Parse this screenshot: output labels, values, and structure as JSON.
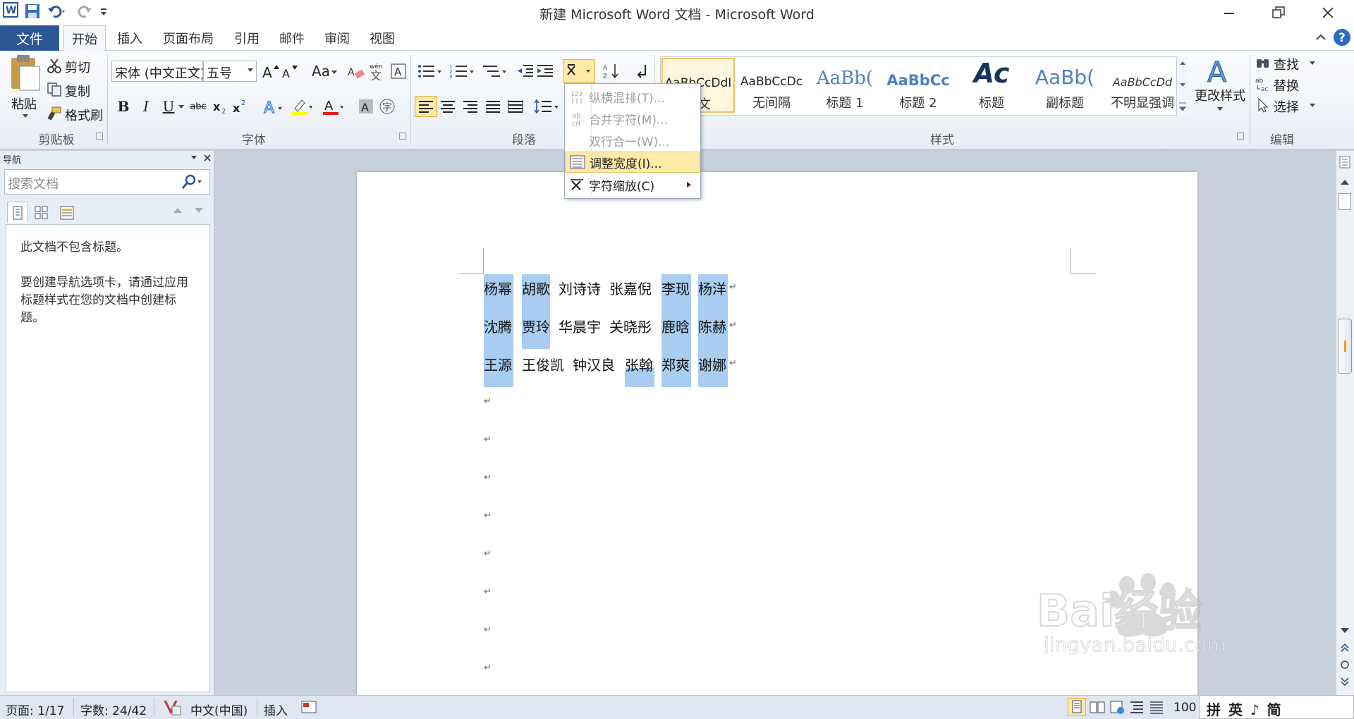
{
  "window": {
    "title": "新建 Microsoft Word 文档 - Microsoft Word"
  },
  "tabs": [
    "文件",
    "开始",
    "插入",
    "页面布局",
    "引用",
    "邮件",
    "审阅",
    "视图"
  ],
  "clipboard": {
    "paste": "粘贴",
    "cut": "剪切",
    "copy": "复制",
    "format_painter": "格式刷",
    "group": "剪贴板"
  },
  "font": {
    "name": "宋体 (中文正文)",
    "size": "五号",
    "group": "字体",
    "case_btn": "Aa"
  },
  "paragraph": {
    "group": "段落"
  },
  "styles": {
    "group": "样式",
    "items": [
      {
        "preview": "AaBbCcDdI",
        "name": "正文"
      },
      {
        "preview": "AaBbCcDc",
        "name": "无间隔"
      },
      {
        "preview": "AaBb(",
        "name": "标题 1"
      },
      {
        "preview": "AaBbCc",
        "name": "标题 2"
      },
      {
        "preview": "Ac",
        "name": "标题"
      },
      {
        "preview": "AaBb(",
        "name": "副标题"
      },
      {
        "preview": "AaBbCcDd",
        "name": "不明显强调"
      }
    ],
    "change_styles": "更改样式"
  },
  "editing": {
    "find": "查找",
    "replace": "替换",
    "select": "选择",
    "group": "编辑"
  },
  "menu": {
    "items": [
      {
        "label": "纵横混排(T)...",
        "enabled": false
      },
      {
        "label": "合并字符(M)...",
        "enabled": false
      },
      {
        "label": "双行合一(W)...",
        "enabled": false
      },
      {
        "label": "调整宽度(I)...",
        "enabled": true,
        "highlighted": true
      },
      {
        "label": "字符缩放(C)",
        "enabled": true,
        "submenu": true
      }
    ]
  },
  "nav": {
    "title": "导航",
    "search_placeholder": "搜索文档",
    "msg1": "此文档不包含标题。",
    "msg2": "要创建导航选项卡，请通过应用标题样式在您的文档中创建标题。"
  },
  "document": {
    "rows": [
      [
        "杨幂",
        "胡歌",
        "刘诗诗",
        "张嘉倪",
        "李现",
        "杨洋"
      ],
      [
        "沈腾",
        "贾玲",
        "华晨宇",
        "关晓彤",
        "鹿晗",
        "陈赫"
      ],
      [
        "王源",
        "王俊凯",
        "钟汉良",
        "张翰",
        "郑爽",
        "谢娜"
      ]
    ],
    "para_mark": "↵"
  },
  "status": {
    "page": "页面: 1/17",
    "words": "字数: 24/42",
    "language": "中文(中国)",
    "mode": "插入",
    "zoom": "100",
    "ime": "拼 英 ♪ 简"
  },
  "watermark": {
    "brand": "Bai经验",
    "url": "jingyan.baidu.com"
  },
  "colors": {
    "file_tab": "#2b5797",
    "selection": "#a8cdf0",
    "menu_highlight": "#fde9a8"
  }
}
